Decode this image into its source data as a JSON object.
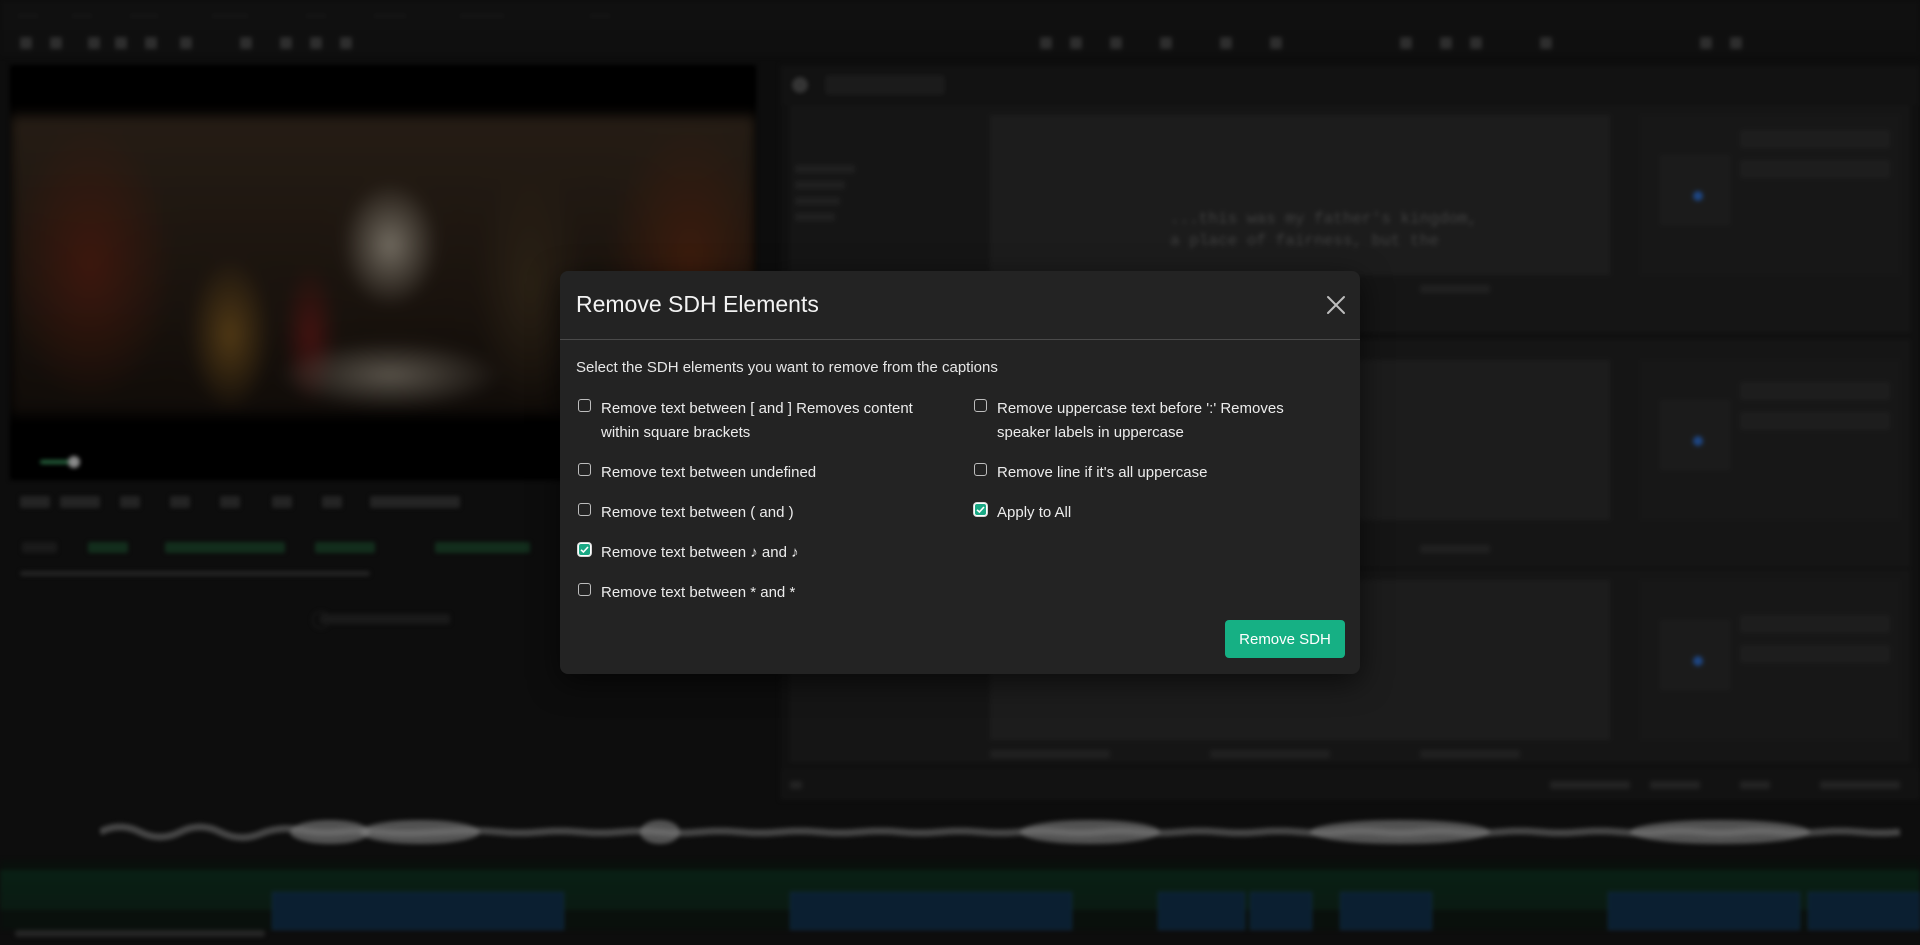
{
  "background_app": {
    "subtitle_preview_lines": [
      "...this was my father's kingdom,",
      "a place of fairness, but the"
    ]
  },
  "modal": {
    "title": "Remove SDH Elements",
    "description": "Select the SDH elements you want to remove from the captions",
    "options_left": [
      {
        "label": "Remove text between [ and ] Removes content within square brackets",
        "checked": false
      },
      {
        "label": "Remove text between undefined",
        "checked": false
      },
      {
        "label": "Remove text between ( and )",
        "checked": false
      },
      {
        "label": "Remove text between ♪ and ♪",
        "checked": true
      },
      {
        "label": "Remove text between * and *",
        "checked": false
      }
    ],
    "options_right": [
      {
        "label": "Remove uppercase text before ':' Removes speaker labels in uppercase",
        "checked": false
      },
      {
        "label": "Remove line if it's all uppercase",
        "checked": false
      },
      {
        "label": "Apply to All",
        "checked": true
      }
    ],
    "submit_label": "Remove SDH",
    "accent_color": "#16b084"
  }
}
